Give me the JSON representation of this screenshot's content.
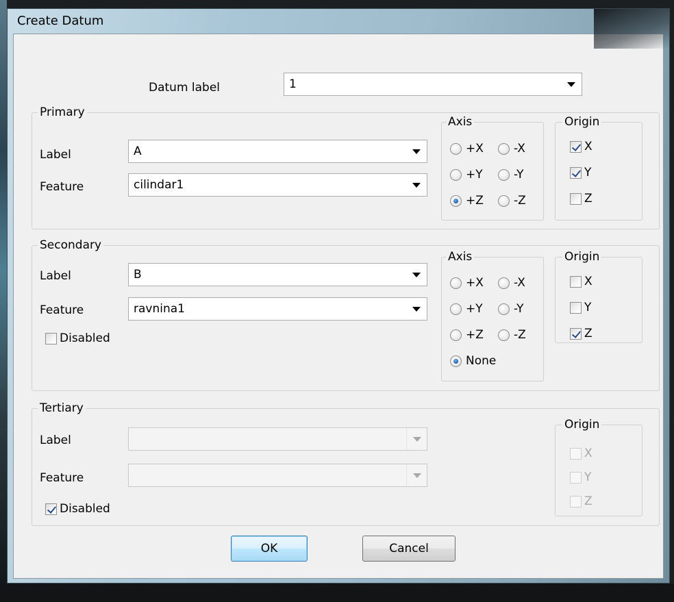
{
  "window": {
    "title": "Create Datum"
  },
  "datum_label": {
    "label": "Datum label",
    "value": "1"
  },
  "primary": {
    "title": "Primary",
    "label_caption": "Label",
    "label_value": "A",
    "feature_caption": "Feature",
    "feature_value": "cilindar1",
    "axis": {
      "title": "Axis",
      "options": [
        "+X",
        "-X",
        "+Y",
        "-Y",
        "+Z",
        "-Z"
      ],
      "selected": "+Z"
    },
    "origin": {
      "title": "Origin",
      "items": [
        {
          "label": "X",
          "checked": true
        },
        {
          "label": "Y",
          "checked": true
        },
        {
          "label": "Z",
          "checked": false
        }
      ]
    }
  },
  "secondary": {
    "title": "Secondary",
    "label_caption": "Label",
    "label_value": "B",
    "feature_caption": "Feature",
    "feature_value": "ravnina1",
    "disabled_label": "Disabled",
    "disabled_checked": false,
    "axis": {
      "title": "Axis",
      "options": [
        "+X",
        "-X",
        "+Y",
        "-Y",
        "+Z",
        "-Z",
        "None"
      ],
      "selected": "None"
    },
    "origin": {
      "title": "Origin",
      "items": [
        {
          "label": "X",
          "checked": false
        },
        {
          "label": "Y",
          "checked": false
        },
        {
          "label": "Z",
          "checked": true
        }
      ]
    }
  },
  "tertiary": {
    "title": "Tertiary",
    "label_caption": "Label",
    "label_value": "",
    "feature_caption": "Feature",
    "feature_value": "",
    "disabled_label": "Disabled",
    "disabled_checked": true,
    "origin": {
      "title": "Origin",
      "items": [
        {
          "label": "X",
          "checked": false
        },
        {
          "label": "Y",
          "checked": false
        },
        {
          "label": "Z",
          "checked": false
        }
      ]
    }
  },
  "buttons": {
    "ok": "OK",
    "cancel": "Cancel"
  },
  "colors": {
    "accent": "#3c7fb1",
    "radio_selected": "#1f5fa8",
    "check_mark": "#2b4a8c"
  }
}
